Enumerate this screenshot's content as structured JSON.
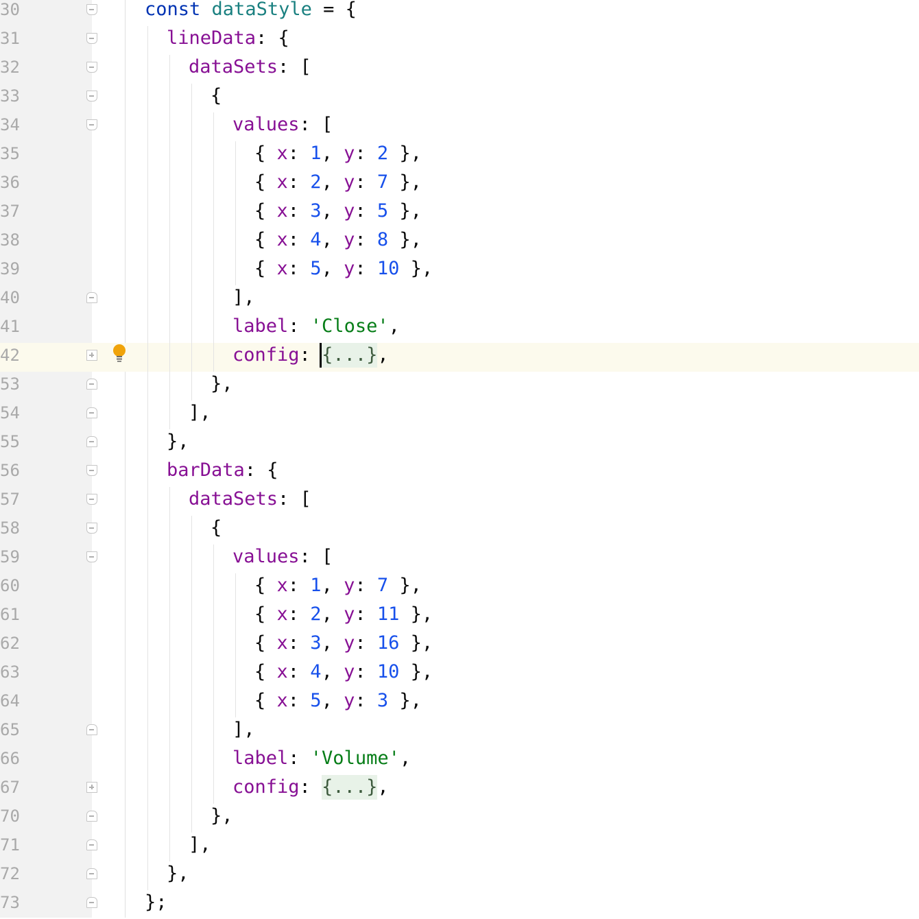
{
  "colors": {
    "keyword": "#0033b3",
    "variable": "#1a8080",
    "property": "#871094",
    "number": "#1750eb",
    "string": "#067d17",
    "plain": "#080808",
    "current_line": "#fcfaed",
    "gutter": "#f2f2f2",
    "line_number": "#a9a9a9"
  },
  "current_line": "42",
  "lines": [
    {
      "n": "30",
      "indent": 0,
      "fold": "start",
      "tokens": [
        [
          "kw",
          "const"
        ],
        [
          "p",
          " "
        ],
        [
          "var",
          "dataStyle"
        ],
        [
          "p",
          " = {"
        ]
      ]
    },
    {
      "n": "31",
      "indent": 1,
      "fold": "start",
      "tokens": [
        [
          "prop",
          "lineData"
        ],
        [
          "p",
          ": {"
        ]
      ]
    },
    {
      "n": "32",
      "indent": 2,
      "fold": "start",
      "tokens": [
        [
          "prop",
          "dataSets"
        ],
        [
          "p",
          ": ["
        ]
      ]
    },
    {
      "n": "33",
      "indent": 3,
      "fold": "start",
      "tokens": [
        [
          "p",
          "{"
        ]
      ]
    },
    {
      "n": "34",
      "indent": 4,
      "fold": "start",
      "tokens": [
        [
          "prop",
          "values"
        ],
        [
          "p",
          ": ["
        ]
      ]
    },
    {
      "n": "35",
      "indent": 5,
      "fold": "",
      "tokens": [
        [
          "p",
          "{ "
        ],
        [
          "prop",
          "x"
        ],
        [
          "p",
          ": "
        ],
        [
          "num",
          "1"
        ],
        [
          "p",
          ", "
        ],
        [
          "prop",
          "y"
        ],
        [
          "p",
          ": "
        ],
        [
          "num",
          "2"
        ],
        [
          "p",
          " },"
        ]
      ]
    },
    {
      "n": "36",
      "indent": 5,
      "fold": "",
      "tokens": [
        [
          "p",
          "{ "
        ],
        [
          "prop",
          "x"
        ],
        [
          "p",
          ": "
        ],
        [
          "num",
          "2"
        ],
        [
          "p",
          ", "
        ],
        [
          "prop",
          "y"
        ],
        [
          "p",
          ": "
        ],
        [
          "num",
          "7"
        ],
        [
          "p",
          " },"
        ]
      ]
    },
    {
      "n": "37",
      "indent": 5,
      "fold": "",
      "tokens": [
        [
          "p",
          "{ "
        ],
        [
          "prop",
          "x"
        ],
        [
          "p",
          ": "
        ],
        [
          "num",
          "3"
        ],
        [
          "p",
          ", "
        ],
        [
          "prop",
          "y"
        ],
        [
          "p",
          ": "
        ],
        [
          "num",
          "5"
        ],
        [
          "p",
          " },"
        ]
      ]
    },
    {
      "n": "38",
      "indent": 5,
      "fold": "",
      "tokens": [
        [
          "p",
          "{ "
        ],
        [
          "prop",
          "x"
        ],
        [
          "p",
          ": "
        ],
        [
          "num",
          "4"
        ],
        [
          "p",
          ", "
        ],
        [
          "prop",
          "y"
        ],
        [
          "p",
          ": "
        ],
        [
          "num",
          "8"
        ],
        [
          "p",
          " },"
        ]
      ]
    },
    {
      "n": "39",
      "indent": 5,
      "fold": "",
      "tokens": [
        [
          "p",
          "{ "
        ],
        [
          "prop",
          "x"
        ],
        [
          "p",
          ": "
        ],
        [
          "num",
          "5"
        ],
        [
          "p",
          ", "
        ],
        [
          "prop",
          "y"
        ],
        [
          "p",
          ": "
        ],
        [
          "num",
          "10"
        ],
        [
          "p",
          " },"
        ]
      ]
    },
    {
      "n": "40",
      "indent": 4,
      "fold": "end",
      "tokens": [
        [
          "p",
          "],"
        ]
      ]
    },
    {
      "n": "41",
      "indent": 4,
      "fold": "",
      "tokens": [
        [
          "prop",
          "label"
        ],
        [
          "p",
          ": "
        ],
        [
          "str",
          "'Close'"
        ],
        [
          "p",
          ","
        ]
      ]
    },
    {
      "n": "42",
      "indent": 4,
      "fold": "collapsed",
      "tokens": [
        [
          "prop",
          "config"
        ],
        [
          "p",
          ": "
        ],
        [
          "fold",
          "{...}"
        ],
        [
          "p",
          ","
        ]
      ]
    },
    {
      "n": "53",
      "indent": 3,
      "fold": "end",
      "tokens": [
        [
          "p",
          "},"
        ]
      ]
    },
    {
      "n": "54",
      "indent": 2,
      "fold": "end",
      "tokens": [
        [
          "p",
          "],"
        ]
      ]
    },
    {
      "n": "55",
      "indent": 1,
      "fold": "end",
      "tokens": [
        [
          "p",
          "},"
        ]
      ]
    },
    {
      "n": "56",
      "indent": 1,
      "fold": "start",
      "tokens": [
        [
          "prop",
          "barData"
        ],
        [
          "p",
          ": {"
        ]
      ]
    },
    {
      "n": "57",
      "indent": 2,
      "fold": "start",
      "tokens": [
        [
          "prop",
          "dataSets"
        ],
        [
          "p",
          ": ["
        ]
      ]
    },
    {
      "n": "58",
      "indent": 3,
      "fold": "start",
      "tokens": [
        [
          "p",
          "{"
        ]
      ]
    },
    {
      "n": "59",
      "indent": 4,
      "fold": "start",
      "tokens": [
        [
          "prop",
          "values"
        ],
        [
          "p",
          ": ["
        ]
      ]
    },
    {
      "n": "60",
      "indent": 5,
      "fold": "",
      "tokens": [
        [
          "p",
          "{ "
        ],
        [
          "prop",
          "x"
        ],
        [
          "p",
          ": "
        ],
        [
          "num",
          "1"
        ],
        [
          "p",
          ", "
        ],
        [
          "prop",
          "y"
        ],
        [
          "p",
          ": "
        ],
        [
          "num",
          "7"
        ],
        [
          "p",
          " },"
        ]
      ]
    },
    {
      "n": "61",
      "indent": 5,
      "fold": "",
      "tokens": [
        [
          "p",
          "{ "
        ],
        [
          "prop",
          "x"
        ],
        [
          "p",
          ": "
        ],
        [
          "num",
          "2"
        ],
        [
          "p",
          ", "
        ],
        [
          "prop",
          "y"
        ],
        [
          "p",
          ": "
        ],
        [
          "num",
          "11"
        ],
        [
          "p",
          " },"
        ]
      ]
    },
    {
      "n": "62",
      "indent": 5,
      "fold": "",
      "tokens": [
        [
          "p",
          "{ "
        ],
        [
          "prop",
          "x"
        ],
        [
          "p",
          ": "
        ],
        [
          "num",
          "3"
        ],
        [
          "p",
          ", "
        ],
        [
          "prop",
          "y"
        ],
        [
          "p",
          ": "
        ],
        [
          "num",
          "16"
        ],
        [
          "p",
          " },"
        ]
      ]
    },
    {
      "n": "63",
      "indent": 5,
      "fold": "",
      "tokens": [
        [
          "p",
          "{ "
        ],
        [
          "prop",
          "x"
        ],
        [
          "p",
          ": "
        ],
        [
          "num",
          "4"
        ],
        [
          "p",
          ", "
        ],
        [
          "prop",
          "y"
        ],
        [
          "p",
          ": "
        ],
        [
          "num",
          "10"
        ],
        [
          "p",
          " },"
        ]
      ]
    },
    {
      "n": "64",
      "indent": 5,
      "fold": "",
      "tokens": [
        [
          "p",
          "{ "
        ],
        [
          "prop",
          "x"
        ],
        [
          "p",
          ": "
        ],
        [
          "num",
          "5"
        ],
        [
          "p",
          ", "
        ],
        [
          "prop",
          "y"
        ],
        [
          "p",
          ": "
        ],
        [
          "num",
          "3"
        ],
        [
          "p",
          " },"
        ]
      ]
    },
    {
      "n": "65",
      "indent": 4,
      "fold": "end",
      "tokens": [
        [
          "p",
          "],"
        ]
      ]
    },
    {
      "n": "66",
      "indent": 4,
      "fold": "",
      "tokens": [
        [
          "prop",
          "label"
        ],
        [
          "p",
          ": "
        ],
        [
          "str",
          "'Volume'"
        ],
        [
          "p",
          ","
        ]
      ]
    },
    {
      "n": "67",
      "indent": 4,
      "fold": "collapsed",
      "tokens": [
        [
          "prop",
          "config"
        ],
        [
          "p",
          ": "
        ],
        [
          "fold",
          "{...}"
        ],
        [
          "p",
          ","
        ]
      ]
    },
    {
      "n": "70",
      "indent": 3,
      "fold": "end",
      "tokens": [
        [
          "p",
          "},"
        ]
      ]
    },
    {
      "n": "71",
      "indent": 2,
      "fold": "end",
      "tokens": [
        [
          "p",
          "],"
        ]
      ]
    },
    {
      "n": "72",
      "indent": 1,
      "fold": "end",
      "tokens": [
        [
          "p",
          "},"
        ]
      ]
    },
    {
      "n": "73",
      "indent": 0,
      "fold": "end",
      "tokens": [
        [
          "p",
          "};"
        ]
      ]
    }
  ],
  "intention_icon": "lightbulb-icon"
}
